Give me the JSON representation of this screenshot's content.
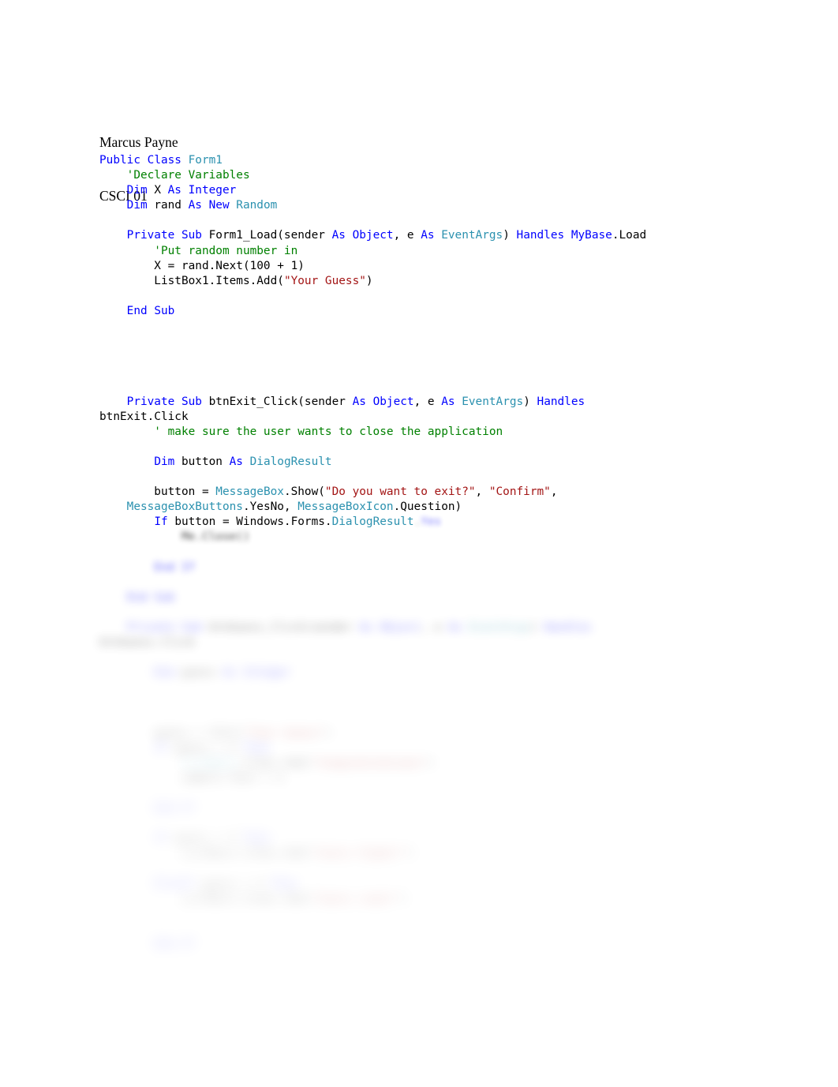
{
  "document": {
    "background_color": "#ffffff",
    "header": {
      "author": "Marcus Payne",
      "course": "CSCI 01"
    },
    "palette": {
      "keyword": "#0000FF",
      "type": "#2B91AF",
      "comment": "#008000",
      "string": "#A31515",
      "plain": "#000000",
      "page": "#FFFFFF"
    },
    "code": {
      "language": "Visual Basic .NET",
      "lines": [
        {
          "blur": 0,
          "tokens": [
            {
              "t": "Public ",
              "c": "kw"
            },
            {
              "t": "Class ",
              "c": "kw"
            },
            {
              "t": "Form1",
              "c": "typ"
            }
          ]
        },
        {
          "blur": 0,
          "tokens": [
            {
              "t": "    'Declare Variables",
              "c": "cmt"
            }
          ]
        },
        {
          "blur": 0,
          "tokens": [
            {
              "t": "    ",
              "c": "pln"
            },
            {
              "t": "Dim ",
              "c": "kw"
            },
            {
              "t": "X ",
              "c": "pln"
            },
            {
              "t": "As ",
              "c": "kw"
            },
            {
              "t": "Integer",
              "c": "kw"
            }
          ]
        },
        {
          "blur": 0,
          "tokens": [
            {
              "t": "    ",
              "c": "pln"
            },
            {
              "t": "Dim ",
              "c": "kw"
            },
            {
              "t": "rand ",
              "c": "pln"
            },
            {
              "t": "As ",
              "c": "kw"
            },
            {
              "t": "New ",
              "c": "kw"
            },
            {
              "t": "Random",
              "c": "typ"
            }
          ]
        },
        {
          "blur": 0,
          "tokens": [
            {
              "t": "",
              "c": "pln"
            }
          ]
        },
        {
          "blur": 0,
          "tokens": [
            {
              "t": "    ",
              "c": "pln"
            },
            {
              "t": "Private ",
              "c": "kw"
            },
            {
              "t": "Sub ",
              "c": "kw"
            },
            {
              "t": "Form1_Load(sender ",
              "c": "pln"
            },
            {
              "t": "As ",
              "c": "kw"
            },
            {
              "t": "Object",
              "c": "kw"
            },
            {
              "t": ", e ",
              "c": "pln"
            },
            {
              "t": "As ",
              "c": "kw"
            },
            {
              "t": "EventArgs",
              "c": "typ"
            },
            {
              "t": ") ",
              "c": "pln"
            },
            {
              "t": "Handles ",
              "c": "kw"
            },
            {
              "t": "MyBase",
              "c": "kw"
            },
            {
              "t": ".Load",
              "c": "pln"
            }
          ]
        },
        {
          "blur": 0,
          "tokens": [
            {
              "t": "        'Put random number in",
              "c": "cmt"
            }
          ]
        },
        {
          "blur": 0,
          "tokens": [
            {
              "t": "        X = rand.Next(100 + 1)",
              "c": "pln"
            }
          ]
        },
        {
          "blur": 0,
          "tokens": [
            {
              "t": "        ListBox1.Items.Add(",
              "c": "pln"
            },
            {
              "t": "\"Your Guess\"",
              "c": "str"
            },
            {
              "t": ")",
              "c": "pln"
            }
          ]
        },
        {
          "blur": 0,
          "tokens": [
            {
              "t": "",
              "c": "pln"
            }
          ]
        },
        {
          "blur": 0,
          "tokens": [
            {
              "t": "    ",
              "c": "pln"
            },
            {
              "t": "End ",
              "c": "kw"
            },
            {
              "t": "Sub",
              "c": "kw"
            }
          ]
        },
        {
          "blur": 0,
          "tokens": [
            {
              "t": "",
              "c": "pln"
            }
          ]
        },
        {
          "blur": 0,
          "tokens": [
            {
              "t": "",
              "c": "pln"
            }
          ]
        },
        {
          "blur": 0,
          "tokens": [
            {
              "t": "",
              "c": "pln"
            }
          ]
        },
        {
          "blur": 0,
          "tokens": [
            {
              "t": "",
              "c": "pln"
            }
          ]
        },
        {
          "blur": 0,
          "tokens": [
            {
              "t": "",
              "c": "pln"
            }
          ]
        },
        {
          "blur": 0,
          "tokens": [
            {
              "t": "    ",
              "c": "pln"
            },
            {
              "t": "Private ",
              "c": "kw"
            },
            {
              "t": "Sub ",
              "c": "kw"
            },
            {
              "t": "btnExit_Click(sender ",
              "c": "pln"
            },
            {
              "t": "As ",
              "c": "kw"
            },
            {
              "t": "Object",
              "c": "kw"
            },
            {
              "t": ", e ",
              "c": "pln"
            },
            {
              "t": "As ",
              "c": "kw"
            },
            {
              "t": "EventArgs",
              "c": "typ"
            },
            {
              "t": ") ",
              "c": "pln"
            },
            {
              "t": "Handles",
              "c": "kw"
            }
          ]
        },
        {
          "blur": 0,
          "tokens": [
            {
              "t": "btnExit.Click",
              "c": "pln"
            }
          ]
        },
        {
          "blur": 0,
          "tokens": [
            {
              "t": "        ' make sure the user wants to close the application",
              "c": "cmt"
            }
          ]
        },
        {
          "blur": 0,
          "tokens": [
            {
              "t": "",
              "c": "pln"
            }
          ]
        },
        {
          "blur": 0,
          "tokens": [
            {
              "t": "        ",
              "c": "pln"
            },
            {
              "t": "Dim ",
              "c": "kw"
            },
            {
              "t": "button ",
              "c": "pln"
            },
            {
              "t": "As ",
              "c": "kw"
            },
            {
              "t": "DialogResult",
              "c": "typ"
            }
          ]
        },
        {
          "blur": 0,
          "tokens": [
            {
              "t": "",
              "c": "pln"
            }
          ]
        },
        {
          "blur": 0,
          "tokens": [
            {
              "t": "        button = ",
              "c": "pln"
            },
            {
              "t": "MessageBox",
              "c": "typ"
            },
            {
              "t": ".Show(",
              "c": "pln"
            },
            {
              "t": "\"Do you want to exit?\"",
              "c": "str"
            },
            {
              "t": ", ",
              "c": "pln"
            },
            {
              "t": "\"Confirm\"",
              "c": "str"
            },
            {
              "t": ",",
              "c": "pln"
            }
          ]
        },
        {
          "blur": 0,
          "tokens": [
            {
              "t": "    ",
              "c": "pln"
            },
            {
              "t": "MessageBoxButtons",
              "c": "typ"
            },
            {
              "t": ".YesNo, ",
              "c": "pln"
            },
            {
              "t": "MessageBoxIcon",
              "c": "typ"
            },
            {
              "t": ".Question)",
              "c": "pln"
            }
          ]
        },
        {
          "blur": 1,
          "partial_blur_from": 4,
          "tokens": [
            {
              "t": "        ",
              "c": "pln"
            },
            {
              "t": "If ",
              "c": "kw"
            },
            {
              "t": "button = Windows.Forms.",
              "c": "pln"
            },
            {
              "t": "DialogResult",
              "c": "typ"
            },
            {
              "t": ".",
              "c": "pln"
            },
            {
              "t": "Yes",
              "c": "kw"
            }
          ]
        },
        {
          "blur": 4,
          "tokens": [
            {
              "t": "            Me.Close()",
              "c": "pln"
            }
          ]
        },
        {
          "blur": 4,
          "tokens": [
            {
              "t": "",
              "c": "pln"
            }
          ]
        },
        {
          "blur": 5,
          "tokens": [
            {
              "t": "        ",
              "c": "pln"
            },
            {
              "t": "End ",
              "c": "kw"
            },
            {
              "t": "If",
              "c": "kw"
            }
          ]
        },
        {
          "blur": 5,
          "tokens": [
            {
              "t": "",
              "c": "pln"
            }
          ]
        },
        {
          "blur": 6,
          "tokens": [
            {
              "t": "    ",
              "c": "pln"
            },
            {
              "t": "End ",
              "c": "kw"
            },
            {
              "t": "Sub",
              "c": "kw"
            }
          ]
        },
        {
          "blur": 6,
          "tokens": [
            {
              "t": "",
              "c": "pln"
            }
          ]
        },
        {
          "blur": 7,
          "tokens": [
            {
              "t": "    ",
              "c": "pln"
            },
            {
              "t": "Private ",
              "c": "kw"
            },
            {
              "t": "Sub ",
              "c": "kw"
            },
            {
              "t": "btnGuess_Click(sender ",
              "c": "pln"
            },
            {
              "t": "As ",
              "c": "kw"
            },
            {
              "t": "Object",
              "c": "kw"
            },
            {
              "t": ", e ",
              "c": "pln"
            },
            {
              "t": "As ",
              "c": "kw"
            },
            {
              "t": "EventArgs",
              "c": "typ"
            },
            {
              "t": ") ",
              "c": "pln"
            },
            {
              "t": "Handles",
              "c": "kw"
            }
          ]
        },
        {
          "blur": 7,
          "tokens": [
            {
              "t": "btnGuess.Click",
              "c": "pln"
            }
          ]
        },
        {
          "blur": 7,
          "tokens": [
            {
              "t": "",
              "c": "pln"
            }
          ]
        },
        {
          "blur": 8,
          "tokens": [
            {
              "t": "        ",
              "c": "pln"
            },
            {
              "t": "Dim ",
              "c": "kw"
            },
            {
              "t": "guess ",
              "c": "pln"
            },
            {
              "t": "As ",
              "c": "kw"
            },
            {
              "t": "Integer",
              "c": "kw"
            }
          ]
        },
        {
          "blur": 8,
          "tokens": [
            {
              "t": "",
              "c": "pln"
            }
          ]
        },
        {
          "blur": 8,
          "tokens": [
            {
              "t": "",
              "c": "pln"
            }
          ]
        },
        {
          "blur": 8,
          "tokens": [
            {
              "t": "",
              "c": "pln"
            }
          ]
        },
        {
          "blur": 9,
          "tokens": [
            {
              "t": "        guess = CInt(",
              "c": "pln"
            },
            {
              "t": "\"Your Guess\"",
              "c": "str"
            },
            {
              "t": ")",
              "c": "pln"
            }
          ]
        },
        {
          "blur": 9,
          "tokens": [
            {
              "t": "        ",
              "c": "pln"
            },
            {
              "t": "If ",
              "c": "kw"
            },
            {
              "t": "guess = X ",
              "c": "pln"
            },
            {
              "t": "Then",
              "c": "kw"
            }
          ]
        },
        {
          "blur": 9,
          "tokens": [
            {
              "t": "            ",
              "c": "pln"
            },
            {
              "t": "ListBox1",
              "c": "typ"
            },
            {
              "t": ".Items.Add(",
              "c": "pln"
            },
            {
              "t": "\"Congratulations\"",
              "c": "str"
            },
            {
              "t": ")",
              "c": "pln"
            }
          ]
        },
        {
          "blur": 9,
          "tokens": [
            {
              "t": "            Label1.Text = X",
              "c": "pln"
            }
          ]
        },
        {
          "blur": 9,
          "tokens": [
            {
              "t": "",
              "c": "pln"
            }
          ]
        },
        {
          "blur": 10,
          "tokens": [
            {
              "t": "        ",
              "c": "pln"
            },
            {
              "t": "End ",
              "c": "kw"
            },
            {
              "t": "If",
              "c": "kw"
            }
          ]
        },
        {
          "blur": 10,
          "tokens": [
            {
              "t": "",
              "c": "pln"
            }
          ]
        },
        {
          "blur": 10,
          "tokens": [
            {
              "t": "        ",
              "c": "pln"
            },
            {
              "t": "If ",
              "c": "kw"
            },
            {
              "t": "guess < X ",
              "c": "pln"
            },
            {
              "t": "Then",
              "c": "kw"
            }
          ]
        },
        {
          "blur": 10,
          "tokens": [
            {
              "t": "            ListBox1.Items.Add(",
              "c": "pln"
            },
            {
              "t": "\"Guess Higher\"",
              "c": "str"
            },
            {
              "t": ")",
              "c": "pln"
            }
          ]
        },
        {
          "blur": 10,
          "tokens": [
            {
              "t": "",
              "c": "pln"
            }
          ]
        },
        {
          "blur": 10,
          "tokens": [
            {
              "t": "        ",
              "c": "pln"
            },
            {
              "t": "ElseIf ",
              "c": "kw"
            },
            {
              "t": "guess > X ",
              "c": "pln"
            },
            {
              "t": "Then",
              "c": "kw"
            }
          ]
        },
        {
          "blur": 10,
          "tokens": [
            {
              "t": "            ListBox1.Items.Add(",
              "c": "pln"
            },
            {
              "t": "\"Guess Lower\"",
              "c": "str"
            },
            {
              "t": ")",
              "c": "pln"
            }
          ]
        },
        {
          "blur": 10,
          "tokens": [
            {
              "t": "",
              "c": "pln"
            }
          ]
        },
        {
          "blur": 10,
          "tokens": [
            {
              "t": "",
              "c": "pln"
            }
          ]
        },
        {
          "blur": 10,
          "tokens": [
            {
              "t": "        ",
              "c": "pln"
            },
            {
              "t": "End ",
              "c": "kw"
            },
            {
              "t": "If",
              "c": "kw"
            }
          ]
        }
      ]
    }
  }
}
